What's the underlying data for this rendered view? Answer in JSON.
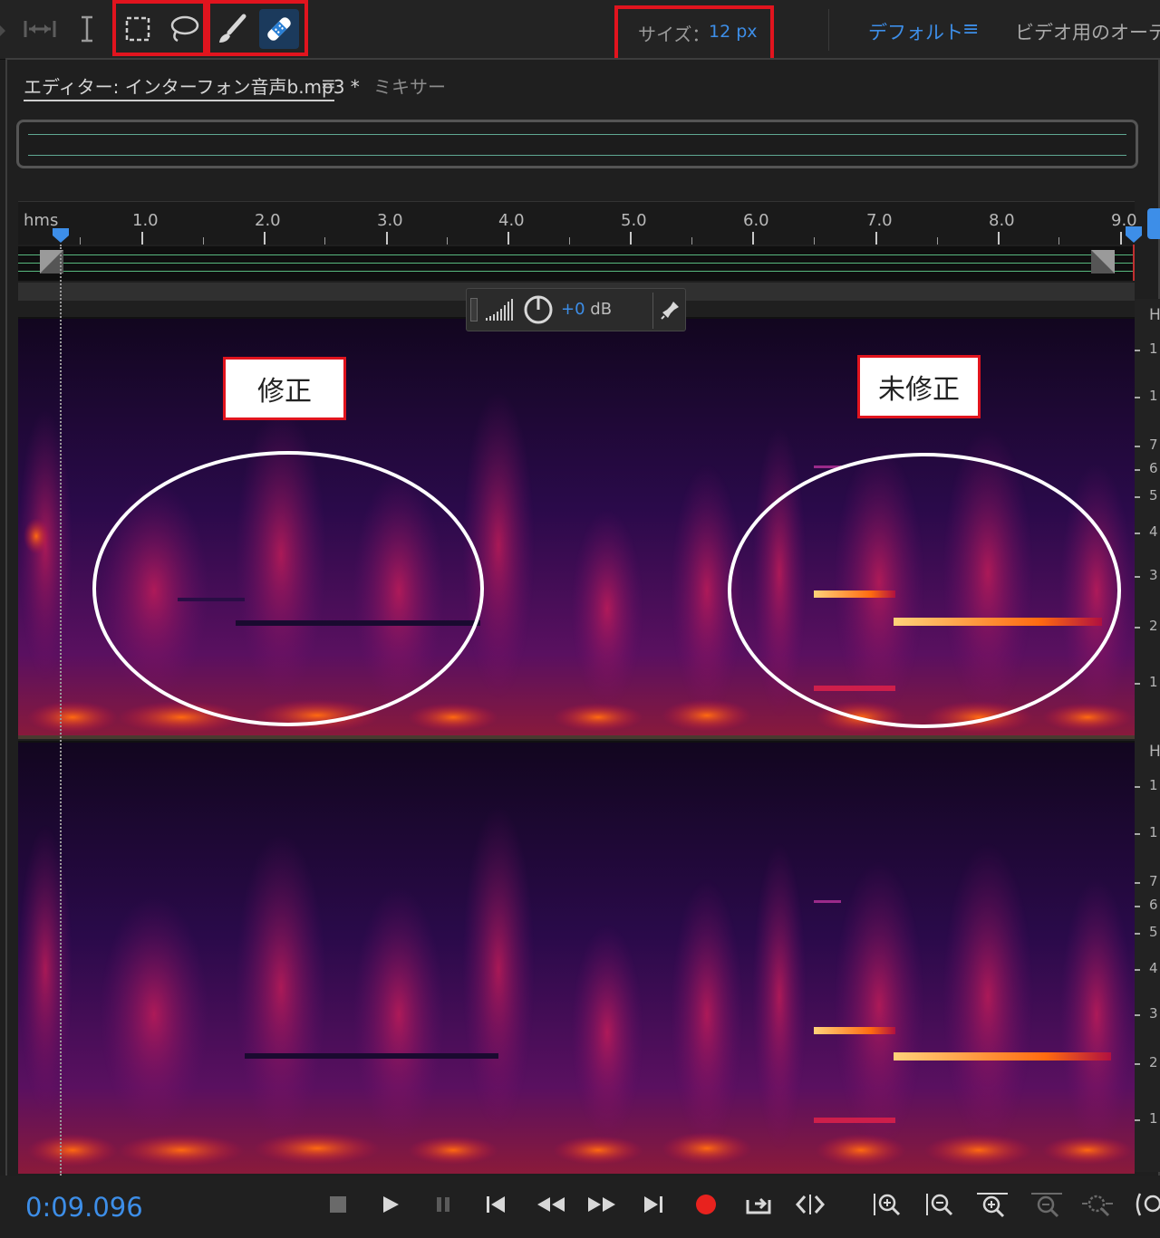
{
  "toolbar": {
    "size_label": "サイズ：",
    "size_value": "12 px",
    "workspace_label": "デフォルト",
    "workspace_menu": "≡",
    "workspace_other": "ビデオ用のオーディオ"
  },
  "tabs": {
    "editor_label": "エディター: インターフォン音声b.mp3 *",
    "editor_menu": "≡",
    "mixer_label": "ミキサー"
  },
  "ruler": {
    "unit": "hms",
    "ticks": [
      "1.0",
      "2.0",
      "3.0",
      "4.0",
      "5.0",
      "6.0",
      "7.0",
      "8.0",
      "9.0"
    ]
  },
  "hud": {
    "gain_sign": "+0",
    "gain_unit": "dB"
  },
  "annotations": {
    "fixed_label": "修正",
    "unfixed_label": "未修正"
  },
  "freq_axis_top": {
    "hz_label": "H",
    "labels": [
      "1",
      "1",
      "7",
      "6",
      "5",
      "4",
      "3",
      "2",
      "1"
    ]
  },
  "freq_axis_bottom": {
    "hz_label": "H",
    "labels": [
      "1",
      "1",
      "7",
      "6",
      "5",
      "4",
      "3",
      "2",
      "1"
    ]
  },
  "transport": {
    "time": "0:09.096"
  },
  "colors": {
    "accent": "#3d8ee8",
    "highlight_box": "#e1141e",
    "spectrogram_bg": "#1a0733",
    "spectrogram_hot": "#ff5a00"
  }
}
